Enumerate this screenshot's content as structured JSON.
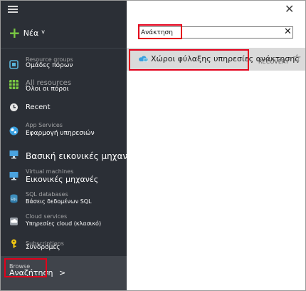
{
  "nav": {
    "new_label": "Νέα",
    "items": [
      {
        "ghost": "Resource groups",
        "label": "Ομάδες πόρων",
        "icon": "resource-groups-icon",
        "color": "#59b4d9"
      },
      {
        "ghost": "All resources",
        "label": "Όλοι οι πόροι",
        "icon": "all-resources-icon",
        "color": "#7ac943"
      },
      {
        "ghost": "",
        "label": "Recent",
        "icon": "clock-icon",
        "color": "#d0d0d0"
      },
      {
        "ghost": "App Services",
        "label": "Εφαρμογή υπηρεσιών",
        "icon": "app-services-icon",
        "color": "#3aa0e0"
      },
      {
        "ghost": "",
        "label": "Βασική εικονικές μηχανές",
        "icon": "virtual-machines-classic-icon",
        "color": "#4aa3df"
      },
      {
        "ghost": "Virtual machines",
        "label": "Εικονικές μηχανές",
        "icon": "virtual-machines-icon",
        "color": "#4aa3df"
      },
      {
        "ghost": "SQL databases",
        "label": "Βάσεις δεδομένων SQL",
        "icon": "sql-database-icon",
        "color": "#3c8dbc"
      },
      {
        "ghost": "Cloud services",
        "label": "Υπηρεσίες cloud (κλασικό)",
        "icon": "cloud-services-icon",
        "color": "#9aa0a8"
      },
      {
        "ghost": "Subscriptions",
        "label": "Συνδρομές",
        "icon": "key-icon",
        "color": "#f2c811"
      }
    ],
    "browse_ghost": "Browse",
    "browse_label": "Αναζήτηση",
    "browse_chevron": ">"
  },
  "flyout": {
    "search_value": "Ανάκτηση",
    "result_label": "Χώροι φύλαξης υπηρεσίες ανάκτησης",
    "result_ghost": "RECOVERY",
    "result_icon": "recovery-vault-icon"
  },
  "colors": {
    "nav_bg": "#2b2f36",
    "browse_bg": "#40444b",
    "highlight_red": "#e3001b",
    "plus_green": "#7ac943",
    "result_bg": "#dadada"
  }
}
